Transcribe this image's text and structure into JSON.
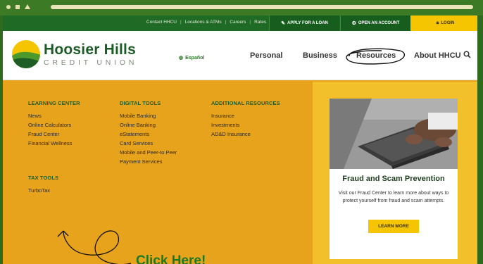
{
  "utility_bar": {
    "links": [
      "Contact HHCU",
      "Locations & ATMs",
      "Careers",
      "Rates"
    ],
    "separator": "|",
    "apply_loan": "APPLY FOR A LOAN",
    "open_account": "OPEN AN ACCOUNT",
    "login": "LOGIN"
  },
  "brand": {
    "name": "Hoosier Hills",
    "subtitle": "CREDIT UNION"
  },
  "header": {
    "language": "Español",
    "nav": [
      "Personal",
      "Business",
      "Resources",
      "About HHCU"
    ],
    "search_icon": "search-icon"
  },
  "menu": {
    "learning_center": {
      "heading": "LEARNING CENTER",
      "items": [
        "News",
        "Online Calculators",
        "Fraud Center",
        "Financial Wellness"
      ]
    },
    "tax_tools": {
      "heading": "TAX TOOLS",
      "items": [
        "TurboTax"
      ]
    },
    "digital_tools": {
      "heading": "DIGITAL TOOLS",
      "items": [
        "Mobile Banking",
        "Online Banking",
        "eStatements",
        "Card Services",
        "Mobile and Peer-to Peer",
        "Payment Services"
      ]
    },
    "additional_resources": {
      "heading": "ADDITIONAL RESOURCES",
      "items": [
        "Insurance",
        "Investments",
        "AD&D Insurance"
      ]
    }
  },
  "promo_card": {
    "title": "Fraud and Scam Prevention",
    "text": "Visit our Fraud Center to learn more about ways to protect yourself from fraud and scam attempts.",
    "button": "LEARN MORE"
  },
  "annotation": {
    "label": "Click Here!"
  },
  "colors": {
    "brand_green": "#1f6a25",
    "menu_orange": "#e8a31c",
    "accent_yellow": "#f4c500"
  }
}
